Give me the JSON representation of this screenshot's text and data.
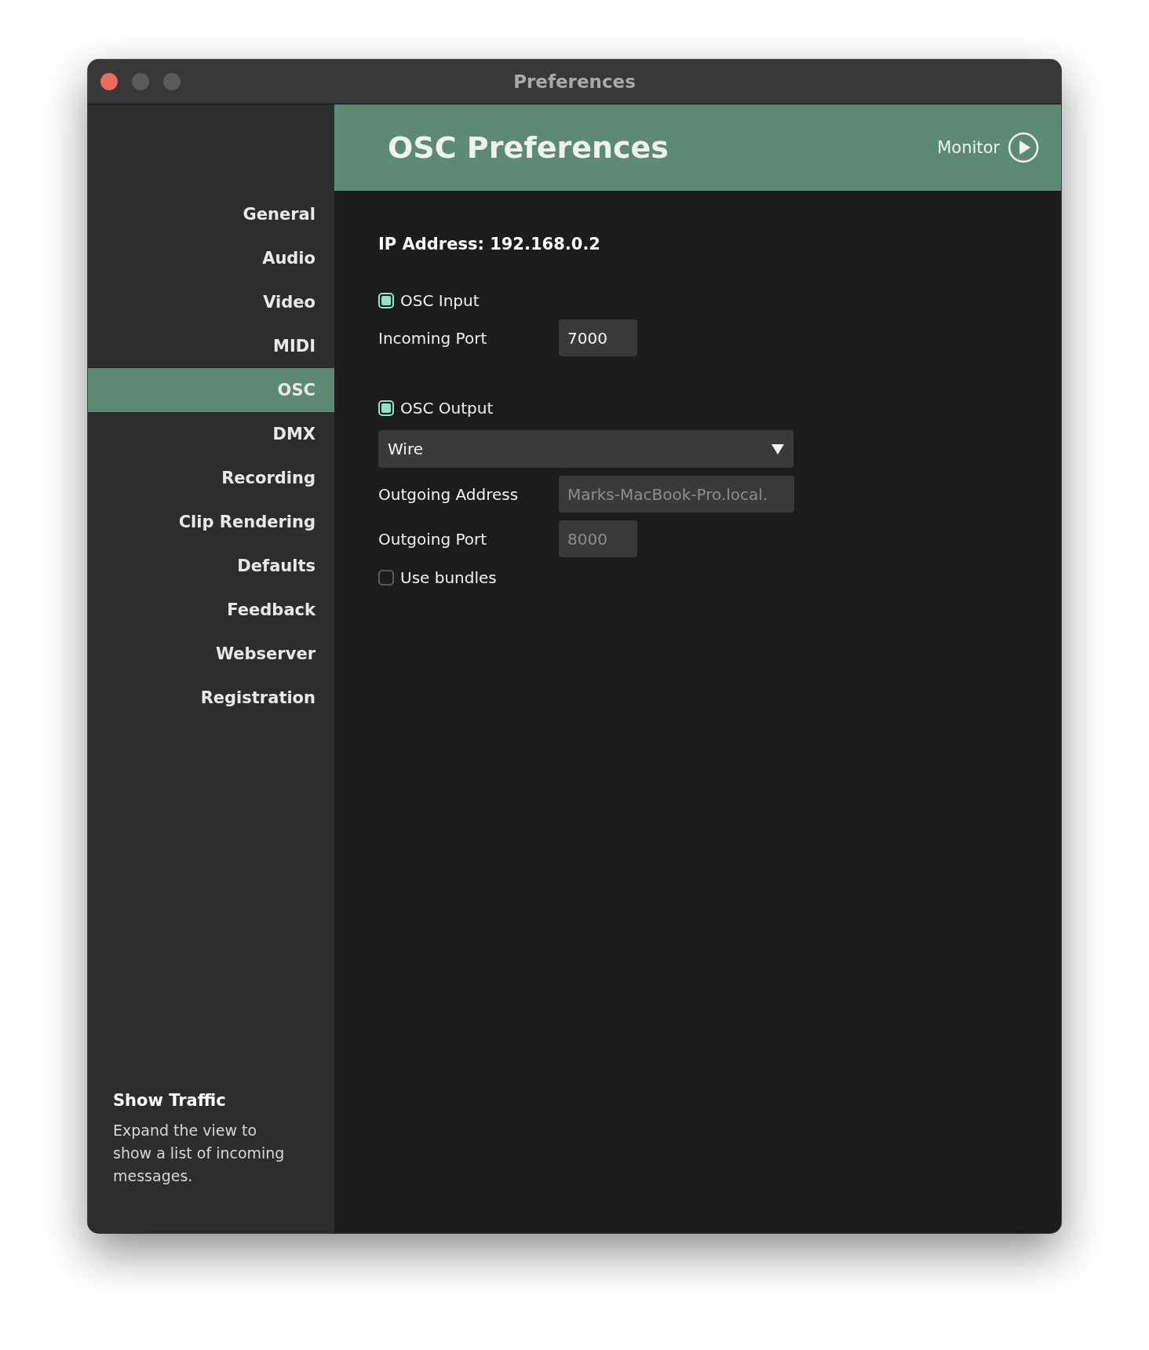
{
  "window": {
    "title": "Preferences"
  },
  "sidebar": {
    "items": [
      {
        "label": "General",
        "selected": false
      },
      {
        "label": "Audio",
        "selected": false
      },
      {
        "label": "Video",
        "selected": false
      },
      {
        "label": "MIDI",
        "selected": false
      },
      {
        "label": "OSC",
        "selected": true
      },
      {
        "label": "DMX",
        "selected": false
      },
      {
        "label": "Recording",
        "selected": false
      },
      {
        "label": "Clip Rendering",
        "selected": false
      },
      {
        "label": "Defaults",
        "selected": false
      },
      {
        "label": "Feedback",
        "selected": false
      },
      {
        "label": "Webserver",
        "selected": false
      },
      {
        "label": "Registration",
        "selected": false
      }
    ],
    "info": {
      "title": "Show Traffic",
      "text": "Expand the view to show a list of incoming messages."
    }
  },
  "header": {
    "title": "OSC Preferences",
    "monitor": "Monitor"
  },
  "ip_address": "IP Address: 192.168.0.2",
  "osc_input": {
    "label": "OSC Input",
    "checked": true,
    "port": {
      "label": "Incoming Port",
      "value": "7000",
      "disabled": false
    }
  },
  "osc_output": {
    "label": "OSC Output",
    "checked": true,
    "transport": "Wire",
    "fields": [
      {
        "label": "Outgoing Address",
        "value": "Marks-MacBook-Pro.local.",
        "disabled": true
      },
      {
        "label": "Outgoing Port",
        "value": "8000",
        "disabled": true
      }
    ],
    "bundles": {
      "label": "Use bundles",
      "checked": false
    }
  }
}
